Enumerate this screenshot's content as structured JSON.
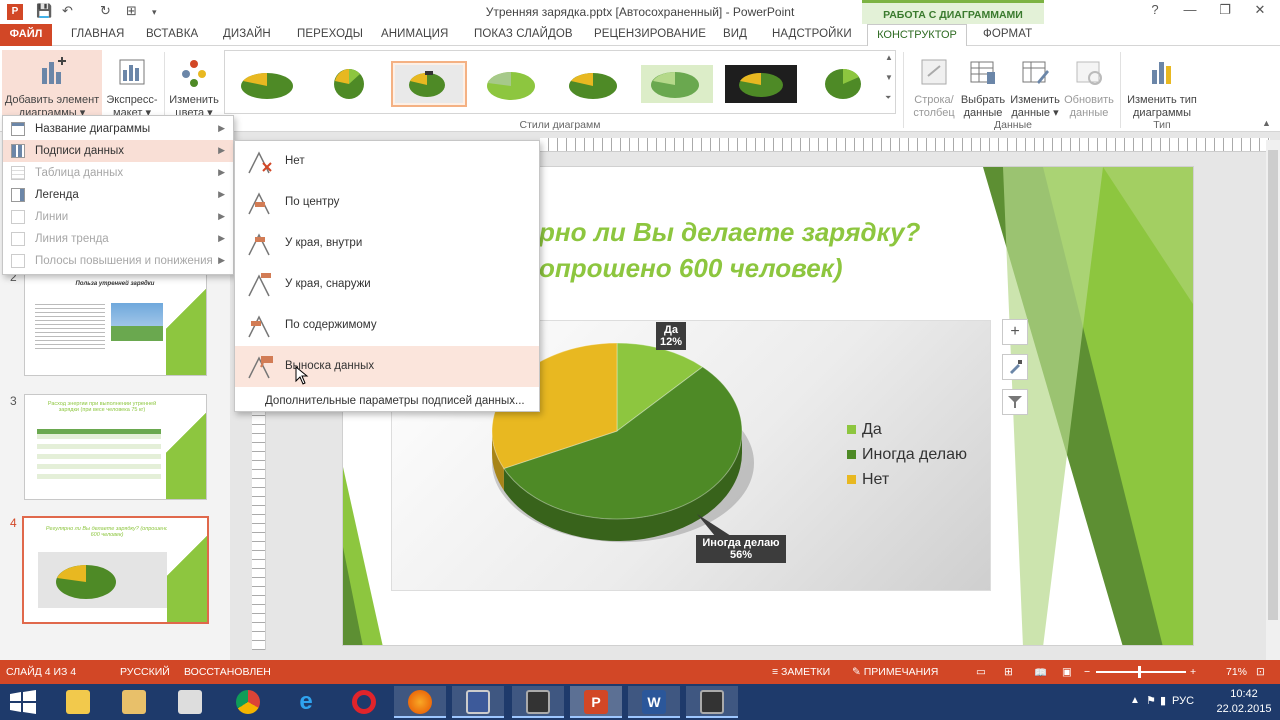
{
  "window": {
    "title": "Утренняя зарядка.pptx [Автосохраненный] - PowerPoint",
    "context_tab_group": "РАБОТА С ДИАГРАММАМИ",
    "controls": [
      "?",
      "—",
      "❐",
      "✕"
    ]
  },
  "tabs": [
    "ФАЙЛ",
    "ГЛАВНАЯ",
    "ВСТАВКА",
    "ДИЗАЙН",
    "ПЕРЕХОДЫ",
    "АНИМАЦИЯ",
    "ПОКАЗ СЛАЙДОВ",
    "РЕЦЕНЗИРОВАНИЕ",
    "ВИД",
    "НАДСТРОЙКИ",
    "КОНСТРУКТОР",
    "ФОРМАТ"
  ],
  "ribbon": {
    "add_element": {
      "line1": "Добавить элемент",
      "line2": "диаграммы ▾"
    },
    "express": {
      "line1": "Экспресс-",
      "line2": "макет ▾"
    },
    "change_colors": {
      "line1": "Изменить",
      "line2": "цвета ▾"
    },
    "styles_group": "Стили диаграмм",
    "row_col": {
      "line1": "Строка/",
      "line2": "столбец"
    },
    "select_data": {
      "line1": "Выбрать",
      "line2": "данные"
    },
    "edit_data": {
      "line1": "Изменить",
      "line2": "данные ▾"
    },
    "refresh_data": {
      "line1": "Обновить",
      "line2": "данные"
    },
    "data_group": "Данные",
    "change_type": {
      "line1": "Изменить тип",
      "line2": "диаграммы"
    },
    "type_group": "Тип"
  },
  "menu": {
    "items": [
      {
        "label": "Название диаграммы",
        "disabled": false
      },
      {
        "label": "Подписи данных",
        "disabled": false
      },
      {
        "label": "Таблица данных",
        "disabled": true
      },
      {
        "label": "Легенда",
        "disabled": false
      },
      {
        "label": "Линии",
        "disabled": true
      },
      {
        "label": "Линия тренда",
        "disabled": true
      },
      {
        "label": "Полосы повышения и понижения",
        "disabled": true
      }
    ]
  },
  "submenu": {
    "items": [
      "Нет",
      "По центру",
      "У края, внутри",
      "У края, снаружи",
      "По содержимому",
      "Выноска данных"
    ],
    "more": "Дополнительные параметры подписей данных..."
  },
  "thumbnails": {
    "slide2": {
      "num": "2",
      "title": "Польза утренней зарядки"
    },
    "slide3": {
      "num": "3",
      "title": "Расход энергии при выполнении утренней зарядки (при весе человека 75 кг)"
    },
    "slide4": {
      "num": "4",
      "title": "Регулярно ли Вы делаете зарядку? (опрошено 600 человек)"
    }
  },
  "slide": {
    "title_line1": "рно ли Вы делаете зарядку?",
    "title_line2": "опрошено 600 человек)"
  },
  "chart_data": {
    "type": "pie",
    "categories": [
      "Да",
      "Иногда  делаю",
      "Нет"
    ],
    "values": [
      12,
      56,
      32
    ],
    "colors": [
      "#8dc63f",
      "#4e8a26",
      "#e8b821"
    ],
    "data_labels": [
      {
        "category": "Да",
        "value": "12%"
      },
      {
        "category": "Иногда  делаю",
        "value": "56%"
      }
    ],
    "legend_position": "right"
  },
  "statusbar": {
    "slide": "СЛАЙД 4 ИЗ 4",
    "lang": "РУССКИЙ",
    "state": "ВОССТАНОВЛЕН",
    "notes": "ЗАМЕТКИ",
    "comments": "ПРИМЕЧАНИЯ",
    "zoom": "71%"
  },
  "taskbar": {
    "lang": "РУС",
    "time": "10:42",
    "date": "22.02.2015"
  }
}
